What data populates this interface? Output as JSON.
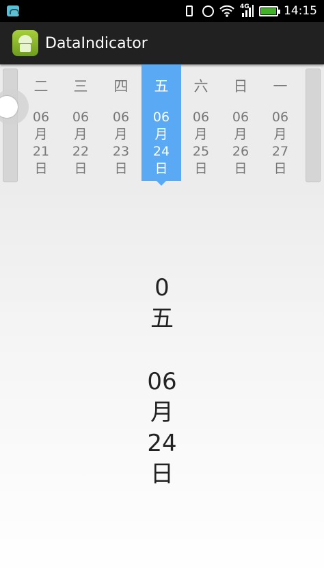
{
  "status_bar": {
    "time": "14:15",
    "network": "4G",
    "icons": [
      "notification-icon",
      "vibrate-icon",
      "alarm-icon",
      "wifi-icon",
      "signal-icon",
      "battery-icon"
    ]
  },
  "action_bar": {
    "title": "DataIndicator",
    "icon": "android-app-icon"
  },
  "days": [
    {
      "weekday": "二",
      "month": "06",
      "m": "月",
      "day": "21",
      "d": "日",
      "selected": false
    },
    {
      "weekday": "三",
      "month": "06",
      "m": "月",
      "day": "22",
      "d": "日",
      "selected": false
    },
    {
      "weekday": "四",
      "month": "06",
      "m": "月",
      "day": "23",
      "d": "日",
      "selected": false
    },
    {
      "weekday": "五",
      "month": "06",
      "m": "月",
      "day": "24",
      "d": "日",
      "selected": true
    },
    {
      "weekday": "六",
      "month": "06",
      "m": "月",
      "day": "25",
      "d": "日",
      "selected": false
    },
    {
      "weekday": "日",
      "month": "06",
      "m": "月",
      "day": "26",
      "d": "日",
      "selected": false
    },
    {
      "weekday": "一",
      "month": "06",
      "m": "月",
      "day": "27",
      "d": "日",
      "selected": false
    }
  ],
  "content": {
    "index": "0",
    "weekday": "五",
    "month": "06",
    "month_char": "月",
    "day": "24",
    "day_char": "日"
  },
  "colors": {
    "selected": "#5aa9f4",
    "action_bar": "#212121",
    "status_bar": "#000000"
  }
}
